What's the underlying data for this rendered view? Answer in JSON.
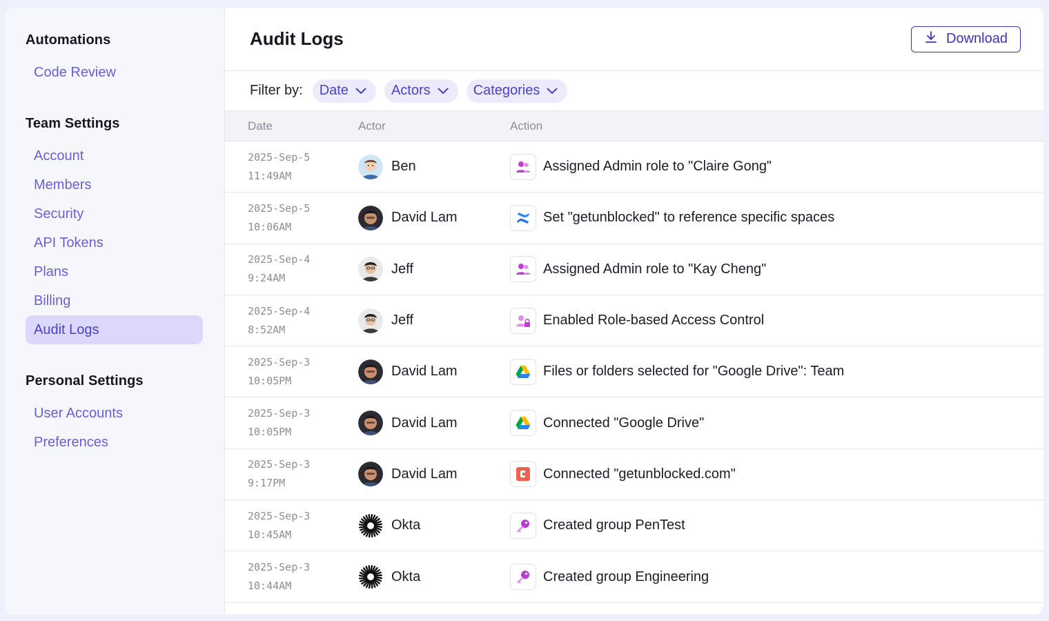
{
  "sidebar": {
    "sections": [
      {
        "heading": "Automations",
        "items": [
          "Code Review"
        ]
      },
      {
        "heading": "Team Settings",
        "items": [
          "Account",
          "Members",
          "Security",
          "API Tokens",
          "Plans",
          "Billing",
          "Audit Logs"
        ]
      },
      {
        "heading": "Personal Settings",
        "items": [
          "User Accounts",
          "Preferences"
        ]
      }
    ],
    "active_item": "Audit Logs"
  },
  "header": {
    "title": "Audit Logs",
    "download_label": "Download"
  },
  "filters": {
    "label": "Filter by:",
    "chips": [
      "Date",
      "Actors",
      "Categories"
    ]
  },
  "table": {
    "columns": [
      "Date",
      "Actor",
      "Action"
    ],
    "rows": [
      {
        "date": "2025-Sep-5",
        "time": "11:49AM",
        "actor": "Ben",
        "action": "Assigned Admin role to \"Claire Gong\"",
        "icon": "users-role-icon"
      },
      {
        "date": "2025-Sep-5",
        "time": "10:06AM",
        "actor": "David Lam",
        "action": "Set \"getunblocked\" to reference specific spaces",
        "icon": "confluence-icon"
      },
      {
        "date": "2025-Sep-4",
        "time": "9:24AM",
        "actor": "Jeff",
        "action": "Assigned Admin role to \"Kay Cheng\"",
        "icon": "users-role-icon"
      },
      {
        "date": "2025-Sep-4",
        "time": "8:52AM",
        "actor": "Jeff",
        "action": "Enabled Role-based Access Control",
        "icon": "users-lock-icon"
      },
      {
        "date": "2025-Sep-3",
        "time": "10:05PM",
        "actor": "David Lam",
        "action": "Files or folders selected for \"Google Drive\": Team",
        "icon": "google-drive-icon"
      },
      {
        "date": "2025-Sep-3",
        "time": "10:05PM",
        "actor": "David Lam",
        "action": "Connected \"Google Drive\"",
        "icon": "google-drive-icon"
      },
      {
        "date": "2025-Sep-3",
        "time": "9:17PM",
        "actor": "David Lam",
        "action": "Connected \"getunblocked.com\"",
        "icon": "web-connector-icon"
      },
      {
        "date": "2025-Sep-3",
        "time": "10:45AM",
        "actor": "Okta",
        "action": "Created group PenTest",
        "icon": "key-icon"
      },
      {
        "date": "2025-Sep-3",
        "time": "10:44AM",
        "actor": "Okta",
        "action": "Created group Engineering",
        "icon": "key-icon"
      }
    ]
  },
  "colors": {
    "accent": "#4c40c9",
    "sidebar_bg": "#f6f6fd",
    "active_bg": "#dcd8fb"
  }
}
